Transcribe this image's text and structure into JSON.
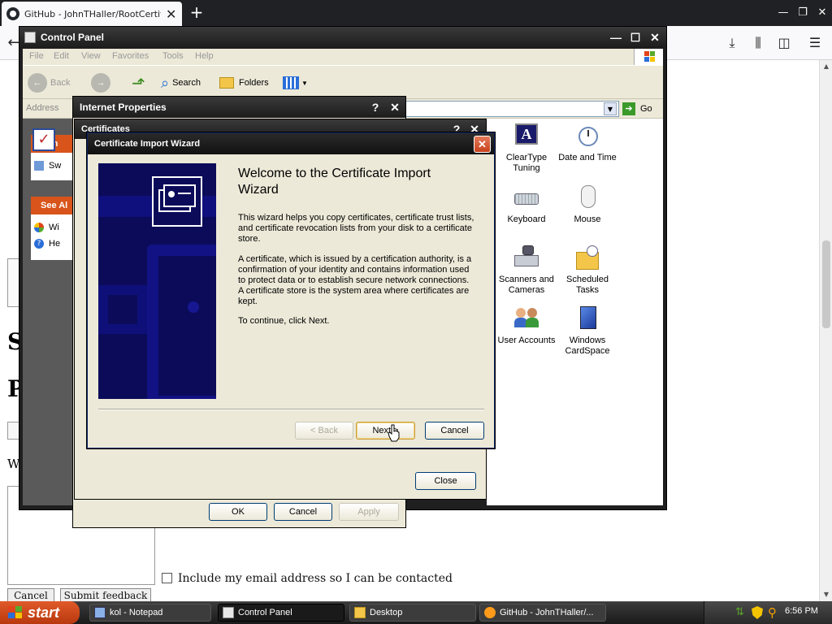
{
  "browser": {
    "tab_title": "GitHub - JohnTHaller/RootCertificat",
    "tab_close": "✕",
    "new_tab": "+"
  },
  "page": {
    "letter_s1": "S",
    "letter_p": "P",
    "letter_w": "W",
    "email_label": "Include my email address so I can be contacted",
    "cancel_label": "Cancel",
    "submit_label": "Submit feedback"
  },
  "control_panel": {
    "title": "Control Panel",
    "menu": [
      "File",
      "Edit",
      "View",
      "Favorites",
      "Tools",
      "Help"
    ],
    "toolbar": {
      "back": "Back",
      "search": "Search",
      "folders": "Folders"
    },
    "address_label": "Address",
    "go_label": "Go",
    "sidebar": {
      "panel1_head": "Con",
      "panel1_item": "Sw",
      "panel2_head": "See Al",
      "panel2_items": [
        "Wi",
        "He"
      ]
    },
    "icons": [
      {
        "label": "ClearType Tuning",
        "icon": "cleartype-icon"
      },
      {
        "label": "Date and Time",
        "icon": "date-time-icon"
      },
      {
        "label": "Keyboard",
        "icon": "keyboard-icon"
      },
      {
        "label": "Mouse",
        "icon": "mouse-icon"
      },
      {
        "label": "Scanners and Cameras",
        "icon": "scanner-icon"
      },
      {
        "label": "Scheduled Tasks",
        "icon": "scheduled-tasks-icon"
      },
      {
        "label": "User Accounts",
        "icon": "user-accounts-icon"
      },
      {
        "label": "Windows CardSpace",
        "icon": "cardspace-icon"
      }
    ]
  },
  "internet_properties": {
    "title": "Internet Properties",
    "ok": "OK",
    "cancel": "Cancel",
    "apply": "Apply"
  },
  "certificates": {
    "title": "Certificates",
    "close": "Close"
  },
  "wizard": {
    "title": "Certificate Import Wizard",
    "heading": "Welcome to the Certificate Import Wizard",
    "para1": "This wizard helps you copy certificates, certificate trust lists, and certificate revocation lists from your disk to a certificate store.",
    "para2": "A certificate, which is issued by a certification authority, is a confirmation of your identity and contains information used to protect data or to establish secure network connections. A certificate store is the system area where certificates are kept.",
    "para3": "To continue, click Next.",
    "back": "< Back",
    "next": "Next >",
    "cancel": "Cancel"
  },
  "taskbar": {
    "start": "start",
    "tasks": [
      "kol - Notepad",
      "Control Panel",
      "Desktop",
      "GitHub - JohnTHaller/..."
    ],
    "active_task": "Control Panel",
    "clock": "6:56 PM"
  },
  "colors": {
    "start_button": "#d8541a",
    "wizard_banner": "#0b0b5a",
    "window_frame": "#1f1f1f",
    "dialog_face": "#ece9d8"
  }
}
